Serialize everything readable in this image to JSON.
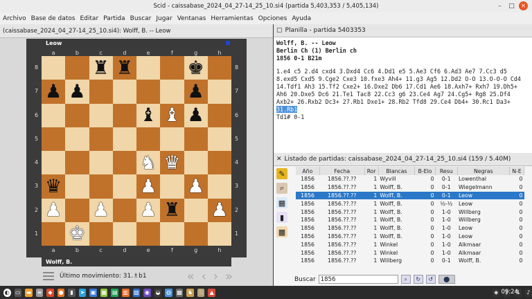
{
  "window": {
    "title": "Scid - caissabase_2024_04_27-14_25_10.si4 (partida 5,403,353 / 5,405,134)"
  },
  "menu": [
    "Archivo",
    "Base de datos",
    "Editar",
    "Partida",
    "Buscar",
    "Jugar",
    "Ventanas",
    "Herramientas",
    "Opciones",
    "Ayuda"
  ],
  "board_pane": {
    "header": "(caissabase_2024_04_27-14_25_10.si4): Wolff, B. -- Leow",
    "top_player": "Leow",
    "bottom_player": "Wolff, B.",
    "files": [
      "a",
      "b",
      "c",
      "d",
      "e",
      "f",
      "g",
      "h"
    ],
    "ranks": [
      "8",
      "7",
      "6",
      "5",
      "4",
      "3",
      "2",
      "1"
    ],
    "last_move_label": "Último movimiento: 31.♗b1",
    "position": [
      [
        "",
        "",
        "bR",
        "bR",
        "",
        "",
        "bK",
        ""
      ],
      [
        "bP",
        "bP",
        "",
        "",
        "",
        "",
        "bP",
        ""
      ],
      [
        "",
        "",
        "",
        "",
        "bB",
        "wB",
        "bP",
        ""
      ],
      [
        "",
        "",
        "",
        "",
        "",
        "",
        "",
        ""
      ],
      [
        "",
        "",
        "",
        "",
        "wN",
        "wQ",
        "",
        ""
      ],
      [
        "bQ",
        "",
        "",
        "",
        "wP",
        "",
        "wP",
        ""
      ],
      [
        "wP",
        "",
        "wP",
        "",
        "wP",
        "bR",
        "",
        "wP"
      ],
      [
        "",
        "wK",
        "",
        "",
        "",
        "",
        "",
        ""
      ]
    ]
  },
  "planilla": {
    "header": "Planilla - partida 5403353",
    "line1": "Wolff, B.   --   Leow",
    "line2": "Berlin Ch (1)  Berlin ch",
    "line3": "1856  0-1  B21m",
    "moves": "1.e4 c5 2.d4 cxd4 3.Dxd4 Cc6 4.Dd1 e5 5.Ae3 Cf6 6.Ad3 Ae7 7.Cc3 d5 8.exd5 Cxd5 9.Cge2 Cxe3 10.fxe3 Ah4+ 11.g3 Ag5 12.Dd2 O-O 13.O-O-O Cd4 14.Tdf1 Ah3 15.Tf2 Cxe2+ 16.Dxe2 Db6 17.Cd1 Ae6 18.Axh7+ Rxh7 19.Dh5+ Ah6 20.Dxe5 Dc6 21.Te1 Tac8 22.Cc3 g6 23.Ce4 Ag7 24.Cg5+ Rg8 25.Df4 Axb2+ 26.Rxb2 Dc3+ 27.Rb1 Dxe1+ 28.Rb2 Tfd8 29.Ce4 Db4+ 30.Rc1 Da3+",
    "current_move": "31.Rb1",
    "moves_end": "Td1# 0-1"
  },
  "game_list": {
    "header": "Listado de partidas: caissabase_2024_04_27-14_25_10.si4 (159 / 5.40M)",
    "columns": [
      "Año",
      "Fecha",
      "Ror",
      "Blancas",
      "B-Elo",
      "Resu",
      "Negras",
      "N-E"
    ],
    "rows": [
      [
        "1856",
        "1856.??.??",
        "1",
        "Wyvill",
        "0",
        "0-1",
        "Lowenthal",
        "0"
      ],
      [
        "1856",
        "1856.??.??",
        "1",
        "Wolff, B.",
        "0",
        "0-1",
        "Wiegelmann",
        "0"
      ],
      [
        "1856",
        "1856.??.??",
        "1",
        "Wolff, B.",
        "0",
        "0-1",
        "Leow",
        "0"
      ],
      [
        "1856",
        "1856.??.??",
        "1",
        "Wolff, B.",
        "0",
        "½-½",
        "Leow",
        "0"
      ],
      [
        "1856",
        "1856.??.??",
        "1",
        "Wolff, B.",
        "0",
        "1-0",
        "Willberg",
        "0"
      ],
      [
        "1856",
        "1856.??.??",
        "1",
        "Wolff, B.",
        "0",
        "1-0",
        "Willberg",
        "0"
      ],
      [
        "1856",
        "1856.??.??",
        "1",
        "Wolff, B.",
        "0",
        "1-0",
        "Leow",
        "0"
      ],
      [
        "1856",
        "1856.??.??",
        "1",
        "Wolff, B.",
        "0",
        "1-0",
        "Leow",
        "0"
      ],
      [
        "1856",
        "1856.??.??",
        "1",
        "Winkel",
        "0",
        "1-0",
        "Alkmaar",
        "0"
      ],
      [
        "1856",
        "1856.??.??",
        "1",
        "Winkel",
        "0",
        "1-0",
        "Alkmaar",
        "0"
      ],
      [
        "1856",
        "1856.??.??",
        "1",
        "Willberg",
        "0",
        "0-1",
        "Wolff, B.",
        "0"
      ]
    ],
    "selected_row": 2,
    "search_label": "Buscar",
    "search_value": "1856"
  },
  "taskbar": {
    "clock": "09:24"
  }
}
